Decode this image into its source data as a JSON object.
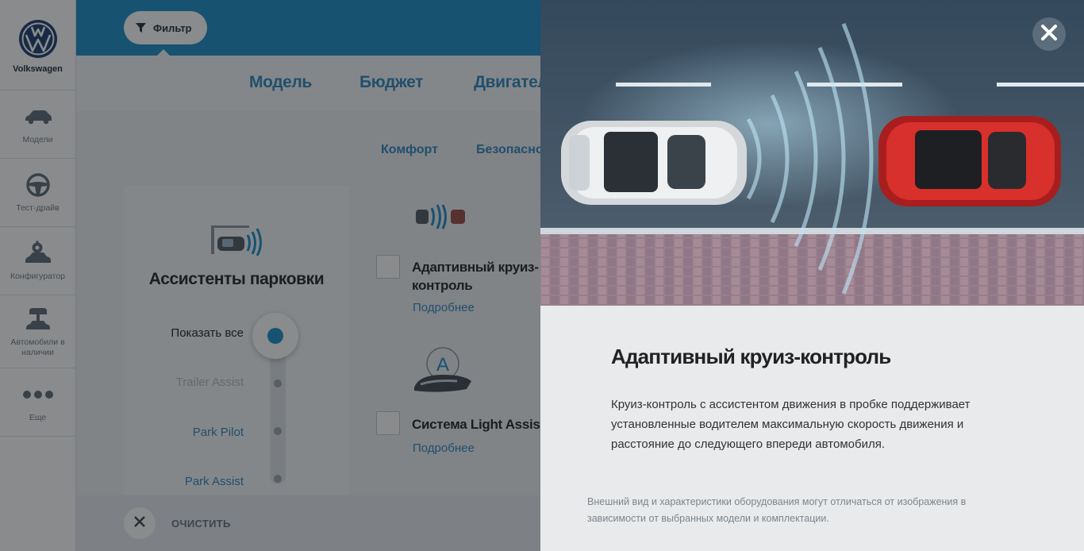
{
  "brand": {
    "name": "Volkswagen",
    "logo": "vw-logo"
  },
  "rail": {
    "items": [
      {
        "label": "Модели",
        "icon": "car-icon"
      },
      {
        "label": "Тест-драйв",
        "icon": "steering-wheel-icon"
      },
      {
        "label": "Конфигуратор",
        "icon": "configurator-icon"
      },
      {
        "label": "Автомобили в наличии",
        "icon": "car-stock-icon"
      },
      {
        "label": "Еще",
        "icon": "more-dots-icon"
      }
    ]
  },
  "toolbar": {
    "filter_label": "Фильтр",
    "filter_icon": "filter-icon",
    "accent": "#1b8cc7"
  },
  "tabs": {
    "model": "Модель",
    "budget": "Бюджет",
    "engine": "Двигатель"
  },
  "subtabs": {
    "comfort": "Комфорт",
    "safety": "Безопасность"
  },
  "parking": {
    "title": "Ассистенты парковки",
    "show_all": "Показать все",
    "options": [
      "Trailer Assist",
      "Park Pilot",
      "Park Assist"
    ]
  },
  "features": [
    {
      "name": "Адаптивный круиз-контроль",
      "more": "Подробнее"
    },
    {
      "name": "Система Light Assist",
      "more": "Подробнее"
    }
  ],
  "clear": {
    "label": "ОЧИСТИТЬ"
  },
  "detail": {
    "title": "Адаптивный круиз-контроль",
    "description": "Круиз-контроль с ассистентом движения в пробке поддерживает установленные водителем максимальную скорость движения и расстояние до следующего впереди автомобиля.",
    "note": "Внешний вид и характеристики оборудования могут отличаться от изображения в зависимости от выбранных модели и комплектации."
  }
}
